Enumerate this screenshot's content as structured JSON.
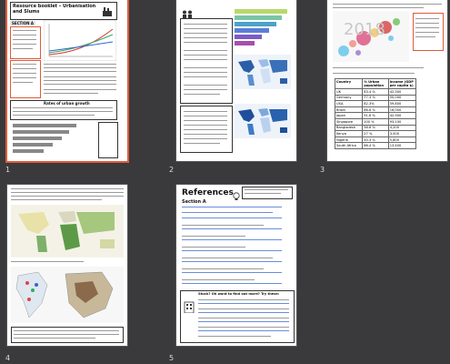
{
  "pages": [
    {
      "number": "1",
      "title": "Resource booklet – Urbanisation and Slums",
      "section": "SECTION A",
      "box_heading": "Rates of urban growth"
    },
    {
      "number": "2"
    },
    {
      "number": "3",
      "big_year": "2018",
      "table_headers": [
        "Country",
        "% Urban population",
        "Income (GDP per capita $)"
      ],
      "table_rows": [
        [
          "UK",
          "83.4 %",
          "42,300"
        ],
        [
          "Germany",
          "77.3 %",
          "50,000"
        ],
        [
          "USA",
          "82.3%",
          "59,800"
        ],
        [
          "Brazil",
          "86.6 %",
          "16,000"
        ],
        [
          "Japan",
          "91.6 %",
          "42,900"
        ],
        [
          "Singapore",
          "100 %",
          "93,100"
        ],
        [
          "Bangladesh",
          "36.6 %",
          "4,200"
        ],
        [
          "Kenya",
          "27 %",
          "3,500"
        ],
        [
          "Nigeria",
          "50.3 %",
          "5,800"
        ],
        [
          "South Africa",
          "66.4 %",
          "13,400"
        ]
      ]
    },
    {
      "number": "4"
    },
    {
      "number": "5",
      "title": "References",
      "section": "Section A",
      "footer_heading": "Stuck? Oh want to find out more? Try these:"
    }
  ],
  "colors": {
    "background": "#3a3a3c",
    "selection": "#e05a3a"
  }
}
